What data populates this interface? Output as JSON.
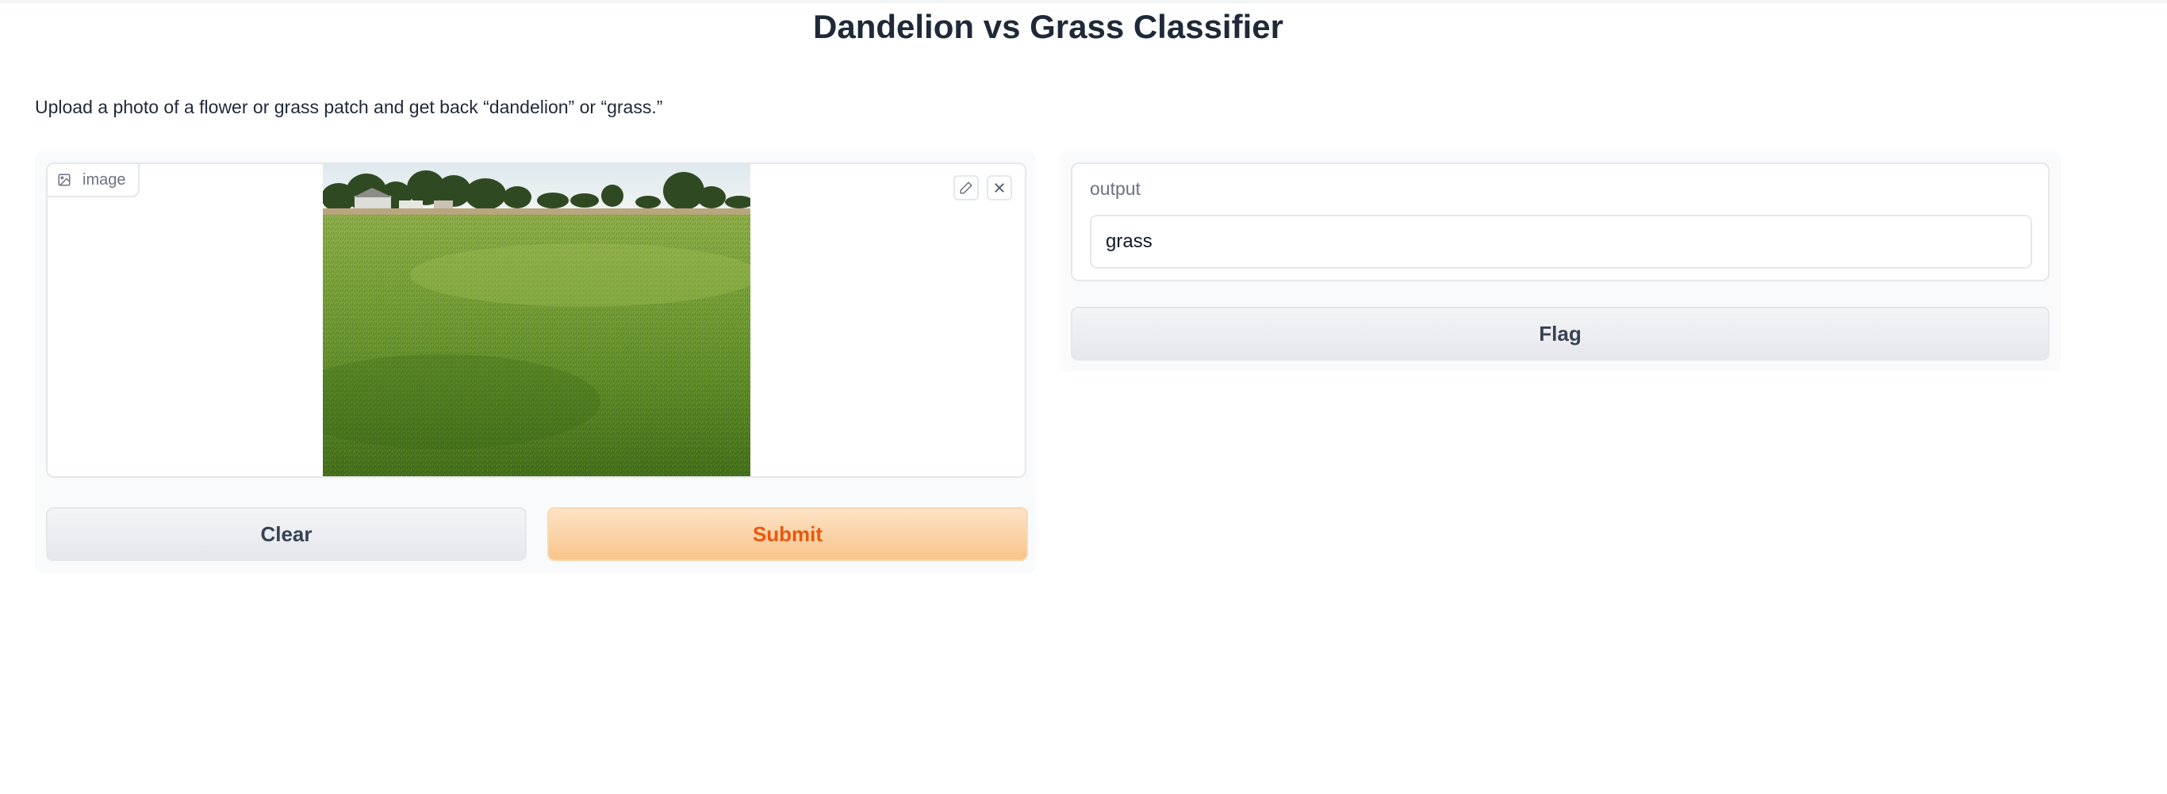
{
  "page": {
    "title": "Dandelion vs Grass Classifier",
    "description": "Upload a photo of a flower or grass patch and get back “dandelion” or “grass.”"
  },
  "input": {
    "label": "image",
    "label_icon": "image-icon",
    "edit_icon": "pencil-icon",
    "clear_icon": "close-icon"
  },
  "buttons": {
    "clear": "Clear",
    "submit": "Submit",
    "flag": "Flag"
  },
  "output": {
    "label": "output",
    "value": "grass"
  },
  "colors": {
    "accent": "#ea580c",
    "primary_bg": "#fbd0a0",
    "secondary_bg": "#e5e7eb"
  }
}
